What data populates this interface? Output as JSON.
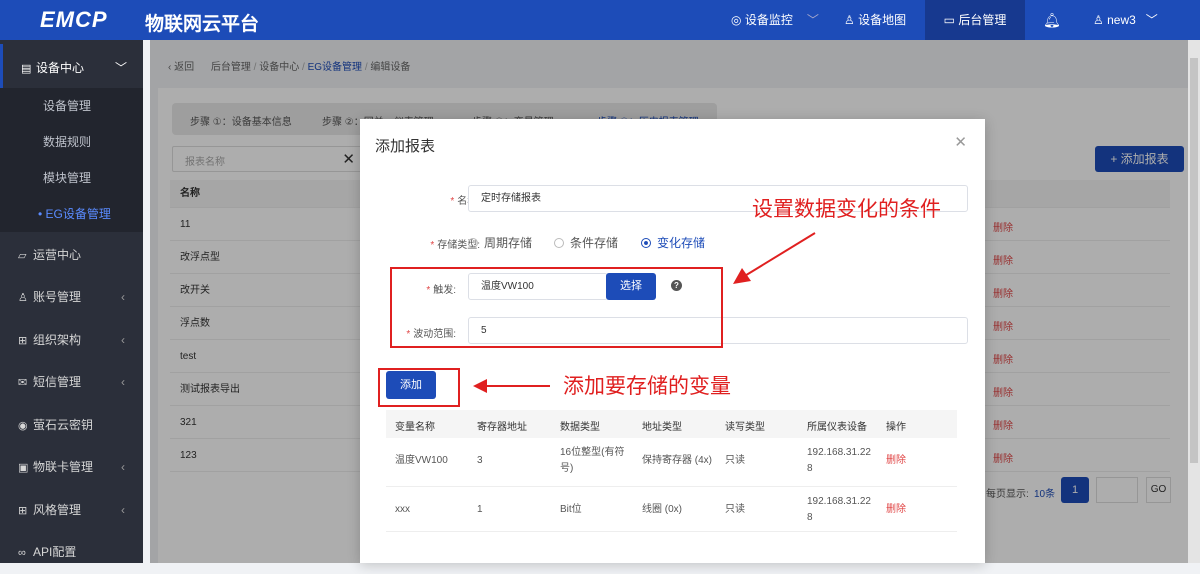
{
  "topbar": {
    "logo": "EMCP",
    "logo_sub": "物联网云平台",
    "nav": [
      "设备监控",
      "设备地图",
      "后台管理"
    ],
    "user": "new3"
  },
  "sidebar": {
    "head": "设备中心",
    "subs": [
      "设备管理",
      "数据规则",
      "模块管理",
      "EG设备管理"
    ],
    "items": [
      "运营中心",
      "账号管理",
      "组织架构",
      "短信管理",
      "萤石云密钥",
      "物联卡管理",
      "风格管理",
      "API配置"
    ]
  },
  "breadcrumb": {
    "back": "返回",
    "path": [
      "后台管理",
      "设备中心",
      "EG设备管理",
      "编辑设备"
    ]
  },
  "steps": [
    "步骤 ①：设备基本信息",
    "步骤 ②：网关、仪表管理",
    "步骤 ③：变量管理",
    "步骤 ④：历史报表管理"
  ],
  "background_page": {
    "search_placeholder": "报表名称",
    "add_button": "+ 添加报表",
    "name_header": "名称",
    "rows": [
      "11",
      "改浮点型",
      "改开关",
      "浮点数",
      "test",
      "测试报表导出",
      "321",
      "123"
    ],
    "delete_label": "删除",
    "pager": {
      "label": "每页显示:",
      "size": "10条",
      "page": "1",
      "go": "GO"
    }
  },
  "modal": {
    "title": "添加报表",
    "name_label": "名称:",
    "name_value": "定时存储报表",
    "storage_label": "存储类型:",
    "storage_options": [
      "周期存储",
      "条件存储",
      "变化存储"
    ],
    "storage_selected": "变化存储",
    "trigger_label": "触发:",
    "trigger_value": "温度VW100",
    "select_button": "选择",
    "range_label": "波动范围:",
    "range_value": "5",
    "add_button": "添加",
    "table": {
      "headers": [
        "变量名称",
        "寄存器地址",
        "数据类型",
        "地址类型",
        "读写类型",
        "所属仪表设备",
        "操作"
      ],
      "rows": [
        [
          "温度VW100",
          "3",
          "16位整型(有符号)",
          "保持寄存器 (4x)",
          "只读",
          "192.168.31.228",
          "删除"
        ],
        [
          "xxx",
          "1",
          "Bit位",
          "线圈 (0x)",
          "只读",
          "192.168.31.228",
          "删除"
        ]
      ]
    }
  },
  "annotations": {
    "condition": "设置数据变化的条件",
    "add_var": "添加要存储的变量"
  },
  "colors": {
    "primary": "#1d4cb8",
    "annotation": "#e02020",
    "danger": "#e04545"
  }
}
